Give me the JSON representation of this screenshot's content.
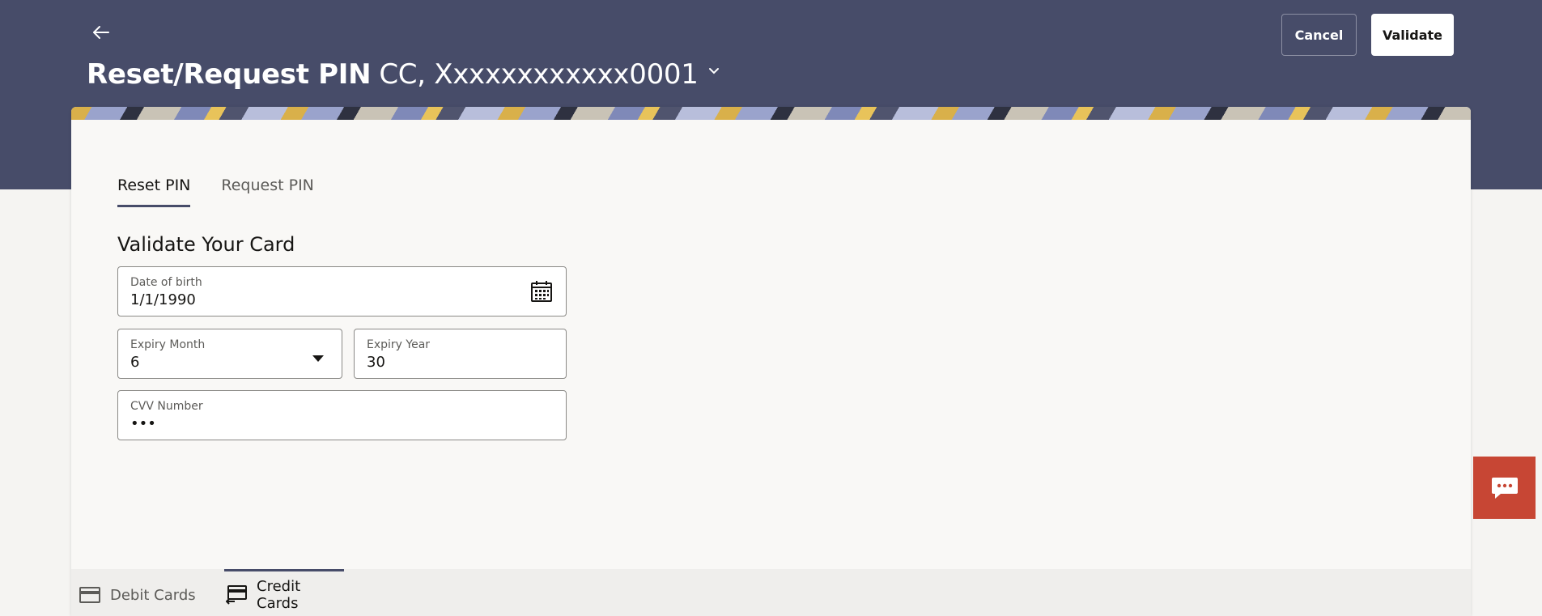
{
  "header": {
    "title": "Reset/Request PIN",
    "account": "CC, Xxxxxxxxxxxx0001",
    "cancel_label": "Cancel",
    "validate_label": "Validate"
  },
  "tabs": [
    {
      "label": "Reset PIN",
      "active": true
    },
    {
      "label": "Request PIN",
      "active": false
    }
  ],
  "form": {
    "section_title": "Validate Your Card",
    "dob": {
      "label": "Date of birth",
      "value": "1/1/1990"
    },
    "expiry_month": {
      "label": "Expiry Month",
      "value": "6"
    },
    "expiry_year": {
      "label": "Expiry Year",
      "value": "30"
    },
    "cvv": {
      "label": "CVV Number",
      "value": "•••"
    }
  },
  "bottom_tabs": [
    {
      "label": "Debit Cards",
      "icon": "debit-card-icon",
      "active": false
    },
    {
      "label": "Credit Cards",
      "icon": "credit-card-icon",
      "active": true
    }
  ],
  "colors": {
    "header_bg": "#474c69",
    "accent": "#474c69",
    "chat_bg": "#c74634"
  }
}
